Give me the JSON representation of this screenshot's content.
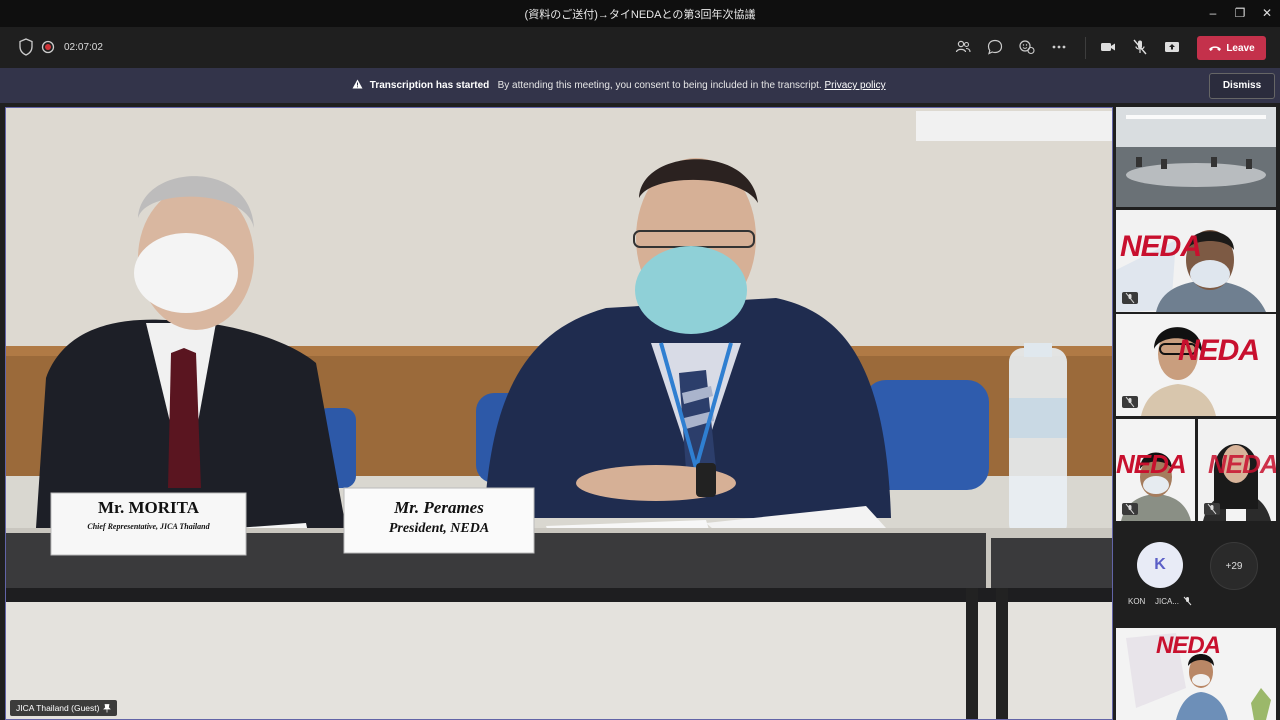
{
  "window": {
    "title": "(資料のご送付)→タイNEDAとの第3回年次協議",
    "minimize_glyph": "–",
    "restore_glyph": "❐",
    "close_glyph": "✕"
  },
  "toolbar": {
    "timer": "02:07:02",
    "leave_label": "Leave",
    "icons": [
      "shield-icon",
      "record-icon",
      "people-icon",
      "chat-icon",
      "reactions-icon",
      "more-icon",
      "camera-icon",
      "mic-off-icon",
      "share-icon",
      "phone-icon"
    ]
  },
  "banner": {
    "title": "Transcription has started",
    "message": "By attending this meeting, you consent to being included in the transcript.",
    "link": "Privacy policy",
    "dismiss_label": "Dismiss"
  },
  "main_video": {
    "placard_left_name": "Mr. MORITA",
    "placard_left_title": "Chief Representative, JICA Thailand",
    "placard_right_name": "Mr. Perames",
    "placard_right_title": "President, NEDA",
    "participant_label": "JICA Thailand (Guest)"
  },
  "participants": {
    "avatar_initial": "K",
    "avatar_name": "KON",
    "second_name": "JICA...",
    "more_count": "+29",
    "neda_text": "NEDA"
  },
  "colors": {
    "leave": "#c4314b",
    "banner": "#33344a",
    "accent": "#6264a7"
  }
}
